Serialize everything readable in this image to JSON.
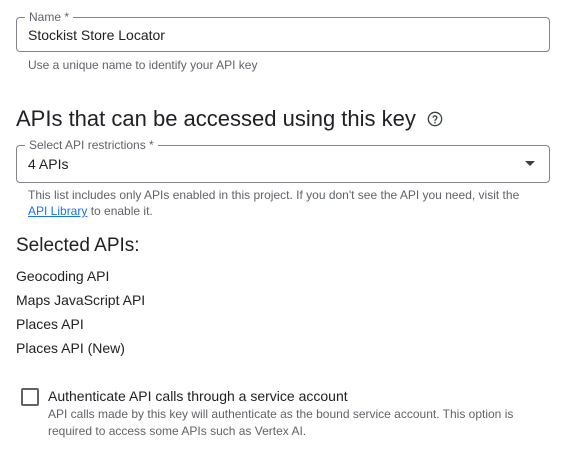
{
  "name_field": {
    "label": "Name *",
    "value": "Stockist Store Locator",
    "hint": "Use a unique name to identify your API key"
  },
  "apis_section": {
    "title": "APIs that can be accessed using this key",
    "help_icon": "help-circle-icon"
  },
  "restrictions_field": {
    "label": "Select API restrictions *",
    "value": "4 APIs",
    "hint_prefix": "This list includes only APIs enabled in this project. If you don't see the API you need, visit the",
    "hint_link": "API Library",
    "hint_suffix": " to enable it.",
    "icon": "arrow-drop-down-icon"
  },
  "selected_apis": {
    "title": "Selected APIs:",
    "items": [
      "Geocoding API",
      "Maps JavaScript API",
      "Places API",
      "Places API (New)"
    ]
  },
  "service_account": {
    "checked": false,
    "label": "Authenticate API calls through a service account",
    "hint": "API calls made by this key will authenticate as the bound service account. This option is required to access some APIs such as Vertex AI."
  }
}
